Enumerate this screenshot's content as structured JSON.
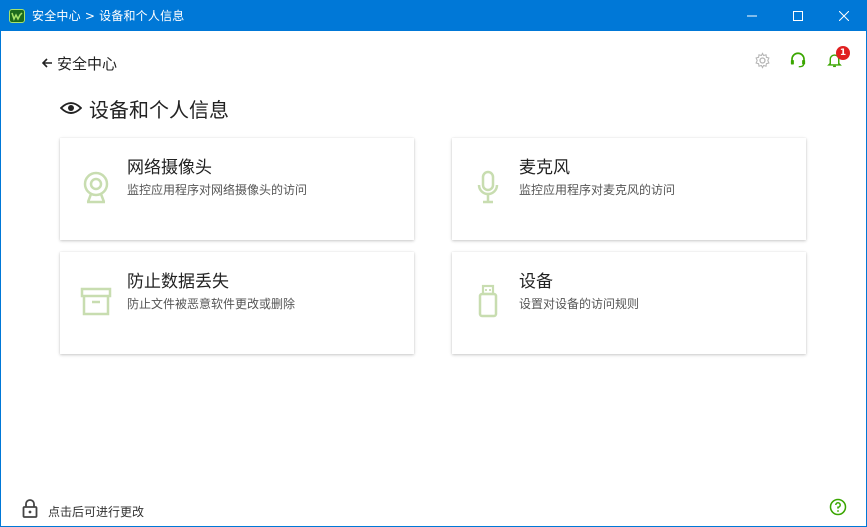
{
  "window": {
    "title": "安全中心 > 设备和个人信息",
    "controls": [
      "minimize",
      "maximize",
      "close"
    ]
  },
  "nav": {
    "back_label": "安全中心"
  },
  "top_icons": {
    "settings": "gear-icon",
    "support": "headset-icon",
    "notifications": "bell-icon",
    "notification_count": "1"
  },
  "page": {
    "title": "设备和个人信息",
    "icon": "eye-icon"
  },
  "cards": [
    {
      "title": "网络摄像头",
      "desc": "监控应用程序对网络摄像头的访问",
      "icon": "webcam-icon"
    },
    {
      "title": "麦克风",
      "desc": "监控应用程序对麦克风的访问",
      "icon": "microphone-icon"
    },
    {
      "title": "防止数据丢失",
      "desc": "防止文件被恶意软件更改或删除",
      "icon": "archive-box-icon"
    },
    {
      "title": "设备",
      "desc": "设置对设备的访问规则",
      "icon": "usb-drive-icon"
    }
  ],
  "footer": {
    "lock_text": "点击后可进行更改",
    "lock_icon": "lock-icon",
    "help_icon": "help-icon"
  },
  "colors": {
    "titlebar": "#0078d7",
    "accent_green": "#3aa600",
    "card_icon": "#c8ddb0",
    "badge": "#e02020"
  }
}
